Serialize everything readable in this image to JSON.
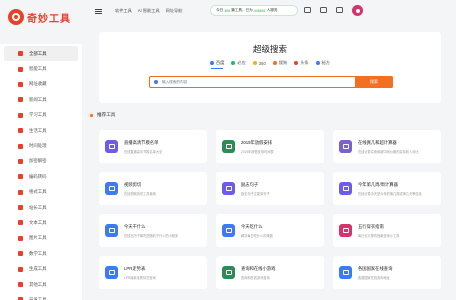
{
  "brand": {
    "name": "奇妙工具"
  },
  "topbar": {
    "links": [
      "软件工具",
      "AI 智能工具",
      "网址导航"
    ],
    "search_text": "今日",
    "search_num1": "366",
    "search_mid": "篇工具，已为",
    "search_num2": "448851",
    "search_tail": "人服务"
  },
  "sidebar": {
    "items": [
      {
        "label": "全部工具",
        "color": "#e8402a"
      },
      {
        "label": "智能工具",
        "color": "#e8402a"
      },
      {
        "label": "网址收藏",
        "color": "#e8402a"
      },
      {
        "label": "新闻工具",
        "color": "#e8402a"
      },
      {
        "label": "学习工具",
        "color": "#e8402a"
      },
      {
        "label": "生活工具",
        "color": "#e8402a"
      },
      {
        "label": "时间处理",
        "color": "#e8402a"
      },
      {
        "label": "加密解密",
        "color": "#e8402a"
      },
      {
        "label": "编码转码",
        "color": "#e8402a"
      },
      {
        "label": "格式工具",
        "color": "#e8402a"
      },
      {
        "label": "站长工具",
        "color": "#e8402a"
      },
      {
        "label": "文本工具",
        "color": "#e8402a"
      },
      {
        "label": "图片工具",
        "color": "#e8402a"
      },
      {
        "label": "数学工具",
        "color": "#e8402a"
      },
      {
        "label": "生成工具",
        "color": "#e8402a"
      },
      {
        "label": "其他工具",
        "color": "#e8402a"
      },
      {
        "label": "开发工具",
        "color": "#e8402a"
      }
    ]
  },
  "search": {
    "title": "超级搜索",
    "engines": [
      {
        "label": "百度",
        "color": "#3b7bf5"
      },
      {
        "label": "必应",
        "color": "#1bb394"
      },
      {
        "label": "360",
        "color": "#f2b01e"
      },
      {
        "label": "搜狗",
        "color": "#f36f23"
      },
      {
        "label": "头条",
        "color": "#e8402a"
      },
      {
        "label": "秘方",
        "color": "#3b7bf5"
      }
    ],
    "placeholder": "输入搜索的内容",
    "button": "搜索"
  },
  "section": {
    "title": "推荐工具"
  },
  "tools": [
    {
      "title": "直播高清节模名单",
      "desc": "在线直播高清节模名单大全",
      "color": "#6c5ce7"
    },
    {
      "title": "2019年放假安排",
      "desc": "2019年放假安排时间表",
      "color": "#2e8b57"
    },
    {
      "title": "在线買几和超计算器",
      "desc": "在线计算买卖和超中间价格的实际收入对比",
      "color": "#7b61c9"
    },
    {
      "title": "视频剪切",
      "desc": "在线视频剪切工具使用",
      "color": "#3b7bf5"
    },
    {
      "title": "励志句子",
      "desc": "励志句子正能量句子",
      "color": "#6c5ce7"
    },
    {
      "title": "今年第几周/周计算器",
      "desc": "在线计算今天是今年的第几周或第几天等信息",
      "color": "#6c5ce7"
    },
    {
      "title": "今天干什么",
      "desc": "在线日历干嘛吃些随机干什么的小程序",
      "color": "#3b7bf5"
    },
    {
      "title": "今天吃什么",
      "desc": "解决每日吃什么的难题",
      "color": "#3b7bf5"
    },
    {
      "title": "五行穿衣指南",
      "desc": "每日五行穿衣指南查询小工具",
      "color": "#d6336c"
    },
    {
      "title": "LPR走势表",
      "desc": "LPR最新走势情况查询",
      "color": "#3b7bf5"
    },
    {
      "title": "查询和在线小游戏",
      "desc": "查询和在线游戏查询",
      "color": "#2e8b57"
    },
    {
      "title": "各国国家在线查询",
      "desc": "各国国家在线查询地址",
      "color": "#3b7bf5"
    }
  ]
}
